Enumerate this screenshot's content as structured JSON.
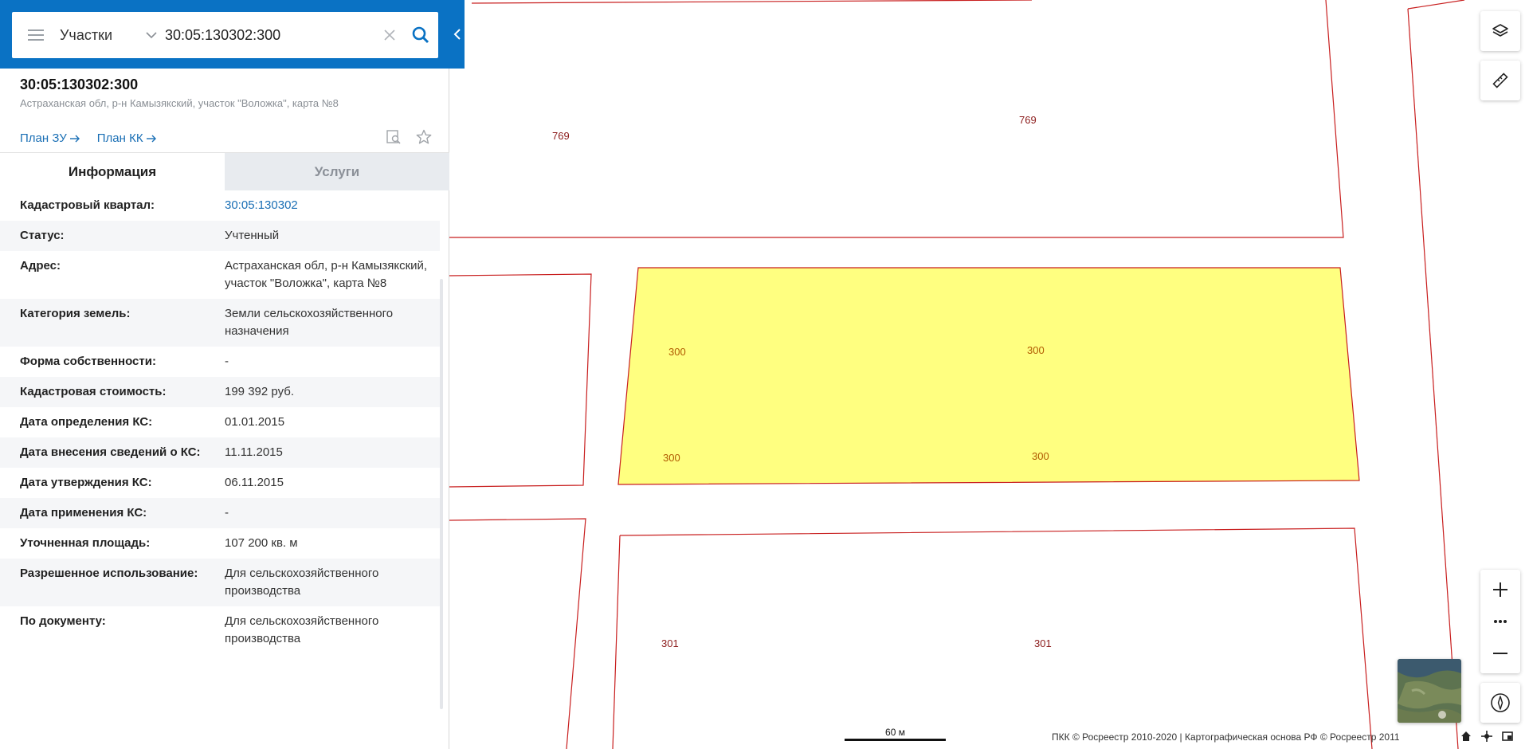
{
  "search": {
    "type_label": "Участки",
    "query": "30:05:130302:300"
  },
  "object": {
    "title": "30:05:130302:300",
    "address": "Астраханская обл, р-н Камызякский, участок \"Воложка\", карта №8"
  },
  "plan_links": {
    "plan_zu": "План ЗУ",
    "plan_kk": "План КК"
  },
  "tabs": {
    "info": "Информация",
    "services": "Услуги"
  },
  "info_rows": [
    {
      "key": "Кадастровый квартал:",
      "value": "30:05:130302",
      "is_link": true
    },
    {
      "key": "Статус:",
      "value": "Учтенный"
    },
    {
      "key": "Адрес:",
      "value": "Астраханская обл, р-н Камызякский, участок \"Воложка\", карта №8"
    },
    {
      "key": "Категория земель:",
      "value": "Земли сельскохозяйственного назначения"
    },
    {
      "key": "Форма собственности:",
      "value": "-"
    },
    {
      "key": "Кадастровая стоимость:",
      "value": "199 392 руб."
    },
    {
      "key": "Дата определения КС:",
      "value": "01.01.2015"
    },
    {
      "key": "Дата внесения сведений о КС:",
      "value": "11.11.2015"
    },
    {
      "key": "Дата утверждения КС:",
      "value": "06.11.2015"
    },
    {
      "key": "Дата применения КС:",
      "value": "-"
    },
    {
      "key": "Уточненная площадь:",
      "value": "107 200 кв. м"
    },
    {
      "key": "Разрешенное использование:",
      "value": "Для сельскохозяйственного производства"
    },
    {
      "key": "По документу:",
      "value": "Для сельскохозяйственного производства"
    }
  ],
  "map": {
    "labels": [
      "769",
      "769",
      "300",
      "300",
      "300",
      "300",
      "301",
      "301"
    ],
    "scale": "60 м",
    "attribution": "ПКК © Росреестр 2010-2020 | Картографическая основа РФ © Росреестр 2011"
  },
  "colors": {
    "header_blue": "#0a72c4",
    "parcel_border": "#c81e1e",
    "selected_fill": "#ffff80",
    "link": "#1a6fb5"
  }
}
